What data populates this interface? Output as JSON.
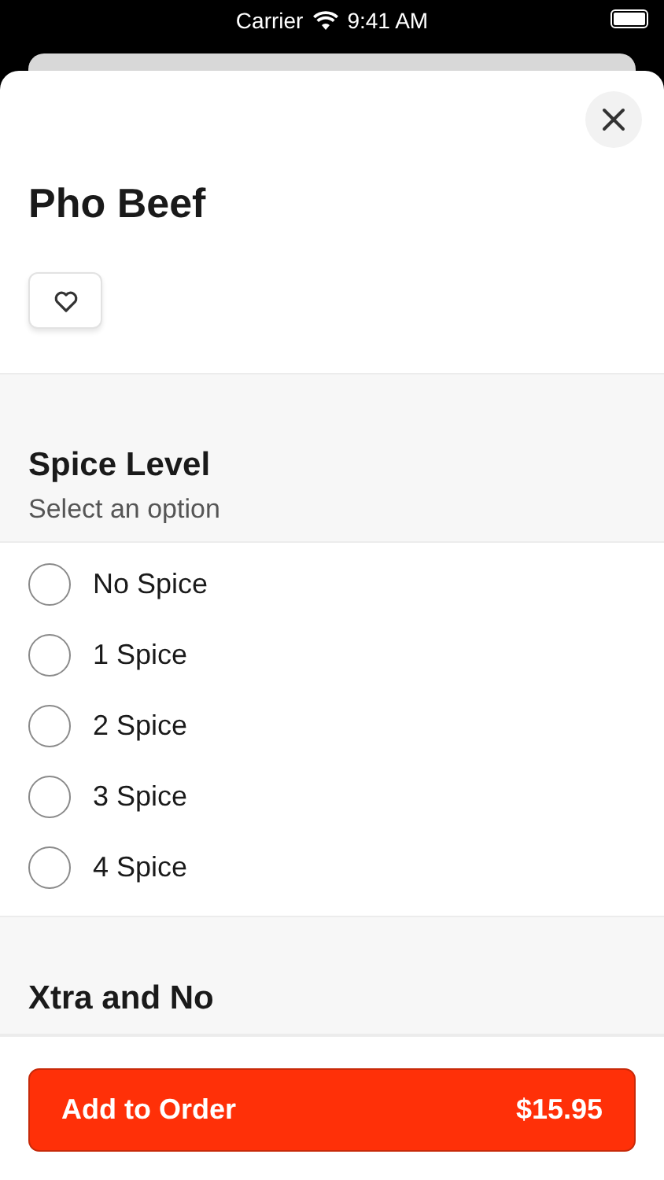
{
  "status_bar": {
    "carrier": "Carrier",
    "time": "9:41 AM"
  },
  "item": {
    "title": "Pho Beef",
    "favorite": false
  },
  "sections": [
    {
      "title": "Spice Level",
      "subtitle": "Select an option",
      "options": [
        {
          "label": "No Spice",
          "selected": false
        },
        {
          "label": "1 Spice",
          "selected": false
        },
        {
          "label": "2 Spice",
          "selected": false
        },
        {
          "label": "3 Spice",
          "selected": false
        },
        {
          "label": "4 Spice",
          "selected": false
        }
      ]
    },
    {
      "title": "Xtra and No"
    }
  ],
  "footer": {
    "button": "Add to Order",
    "price": "$15.95"
  }
}
